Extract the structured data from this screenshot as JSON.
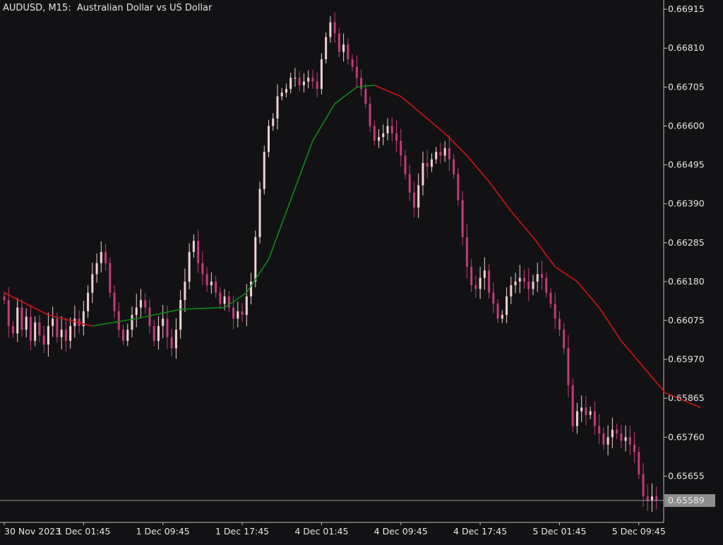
{
  "window": {
    "title": "AUDUSD, M15:  Australian Dollar vs US Dollar"
  },
  "colors": {
    "background": "#121214",
    "axis": "#bdbdbd",
    "text": "#e6e6e6",
    "candle_up": "#f3d1d3",
    "candle_down": "#c23b78",
    "ma_up": "#0c8a17",
    "ma_down": "#d01414",
    "price_line": "#9a9a9a",
    "price_label_bg": "#8d8d8d"
  },
  "chart_data": {
    "type": "candlestick",
    "symbol": "AUDUSD",
    "timeframe": "M15",
    "description": "Australian Dollar vs US Dollar",
    "ylim": [
      0.6553,
      0.6694
    ],
    "y_ticks": [
      "0.66915",
      "0.66810",
      "0.66705",
      "0.66600",
      "0.66495",
      "0.66390",
      "0.66285",
      "0.66180",
      "0.66075",
      "0.65970",
      "0.65865",
      "0.65760",
      "0.65655"
    ],
    "x_ticks": [
      "30 Nov 2023",
      "1 Dec 01:45",
      "1 Dec 09:45",
      "1 Dec 17:45",
      "4 Dec 01:45",
      "4 Dec 09:45",
      "4 Dec 17:45",
      "5 Dec 01:45",
      "5 Dec 09:45"
    ],
    "current_price": "0.65589",
    "price_series": [
      0.6613,
      0.6606,
      0.6604,
      0.6611,
      0.6605,
      0.66085,
      0.6602,
      0.6607,
      0.66035,
      0.6601,
      0.6606,
      0.6608,
      0.6603,
      0.6605,
      0.6602,
      0.6606,
      0.6608,
      0.6606,
      0.661,
      0.6615,
      0.662,
      0.6623,
      0.6626,
      0.6623,
      0.6615,
      0.661,
      0.6605,
      0.6602,
      0.6605,
      0.6609,
      0.6611,
      0.6613,
      0.6611,
      0.6606,
      0.6602,
      0.6606,
      0.6608,
      0.6603,
      0.66,
      0.6605,
      0.6613,
      0.6618,
      0.6626,
      0.6629,
      0.6623,
      0.662,
      0.6617,
      0.6618,
      0.6615,
      0.6612,
      0.6614,
      0.6611,
      0.6608,
      0.661,
      0.6609,
      0.6614,
      0.6618,
      0.663,
      0.6643,
      0.6653,
      0.666,
      0.6662,
      0.6668,
      0.6669,
      0.667,
      0.6673,
      0.6673,
      0.6671,
      0.6672,
      0.6673,
      0.6672,
      0.667,
      0.6678,
      0.6684,
      0.6688,
      0.6685,
      0.668,
      0.6682,
      0.6678,
      0.6676,
      0.6673,
      0.667,
      0.6666,
      0.666,
      0.6656,
      0.6657,
      0.6658,
      0.666,
      0.6658,
      0.6656,
      0.6652,
      0.6647,
      0.6642,
      0.6638,
      0.6644,
      0.665,
      0.6649,
      0.6651,
      0.6653,
      0.6652,
      0.6654,
      0.6651,
      0.6647,
      0.664,
      0.663,
      0.6622,
      0.6617,
      0.6616,
      0.6619,
      0.6621,
      0.6615,
      0.6612,
      0.6608,
      0.6609,
      0.6614,
      0.6617,
      0.6618,
      0.6619,
      0.6618,
      0.6616,
      0.6618,
      0.662,
      0.6619,
      0.6615,
      0.6612,
      0.6608,
      0.6605,
      0.66,
      0.659,
      0.6579,
      0.6583,
      0.6584,
      0.6582,
      0.6583,
      0.6579,
      0.6577,
      0.6574,
      0.6576,
      0.6578,
      0.6577,
      0.6575,
      0.6576,
      0.6574,
      0.6572,
      0.6566,
      0.656,
      0.6559,
      0.656,
      0.65589
    ],
    "moving_average": [
      [
        0,
        0.6615
      ],
      [
        10,
        0.6609
      ],
      [
        20,
        0.6606
      ],
      [
        30,
        0.6608
      ],
      [
        40,
        0.66105
      ],
      [
        50,
        0.6611
      ],
      [
        55,
        0.6615
      ],
      [
        60,
        0.6624
      ],
      [
        65,
        0.664
      ],
      [
        70,
        0.6656
      ],
      [
        75,
        0.6666
      ],
      [
        80,
        0.66705
      ],
      [
        84,
        0.6671
      ],
      [
        90,
        0.6668
      ],
      [
        96,
        0.6662
      ],
      [
        100,
        0.6658
      ],
      [
        105,
        0.6652
      ],
      [
        110,
        0.6645
      ],
      [
        115,
        0.6637
      ],
      [
        120,
        0.663
      ],
      [
        125,
        0.6622
      ],
      [
        130,
        0.6618
      ],
      [
        135,
        0.6611
      ],
      [
        140,
        0.6602
      ],
      [
        145,
        0.6595
      ],
      [
        150,
        0.6588
      ],
      [
        158,
        0.6584
      ]
    ],
    "grid": false,
    "legend": "none"
  }
}
